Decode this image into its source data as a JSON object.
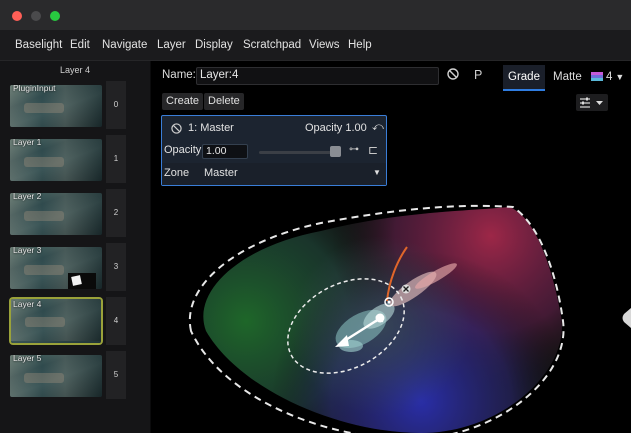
{
  "window": {
    "traffic_lights": {
      "close": "#ff5f57",
      "minimize": "#febc2e",
      "maximize": "#28c840"
    }
  },
  "menu": [
    "Baselight",
    "Edit",
    "Navigate",
    "Layer",
    "Display",
    "Scratchpad",
    "Views",
    "Help"
  ],
  "sidebar": {
    "title": "Layer 4",
    "layers": [
      {
        "label": "PluginInput",
        "number": "0"
      },
      {
        "label": "Layer 1",
        "number": "1"
      },
      {
        "label": "Layer 2",
        "number": "2"
      },
      {
        "label": "Layer 3",
        "number": "3"
      },
      {
        "label": "Layer 4",
        "number": "4"
      },
      {
        "label": "Layer 5",
        "number": "5"
      }
    ],
    "selected_index": 4
  },
  "header": {
    "name_label": "Name:",
    "name_value": "Layer:4",
    "bypass_icon": "circle-slash-icon",
    "p_label": "P",
    "tabs": {
      "grade": "Grade",
      "matte": "Matte",
      "count": "4"
    }
  },
  "toolbar": {
    "create": "Create",
    "delete": "Delete"
  },
  "operator": {
    "title": "1: Master",
    "opacity_header": "Opacity 1.00",
    "opacity_label": "Opacity",
    "opacity_value": "1.00",
    "opacity_level": 1.0,
    "zone_label": "Zone",
    "zone_value": "Master"
  },
  "colors": {
    "accent": "#2f7de1",
    "selection": "#9aa23a",
    "panel_border": "#3a7ed8"
  }
}
